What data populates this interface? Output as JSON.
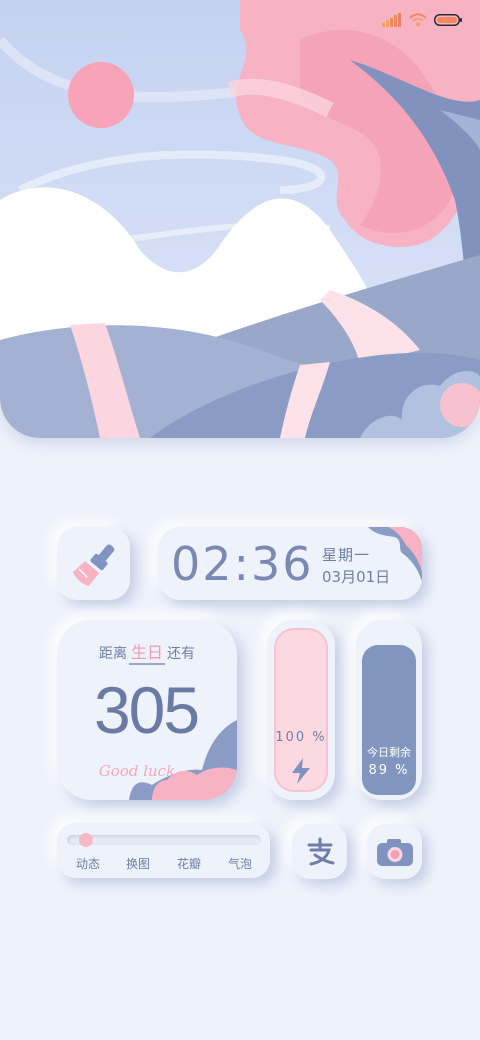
{
  "status_bar": {
    "icons": [
      "signal-icon",
      "wifi-icon",
      "battery-icon"
    ]
  },
  "clock": {
    "time": "02:36",
    "weekday": "星期一",
    "date": "03月01日"
  },
  "birthday": {
    "prefix": "距离",
    "highlight": "生日",
    "suffix": "还有",
    "days": "305",
    "caption": "Good luck"
  },
  "battery": {
    "percent_label": "100 %",
    "level": 1.0
  },
  "storage": {
    "label": "今日剩余",
    "percent_label": "89 %",
    "level": 0.89
  },
  "effects": {
    "items": [
      "动态",
      "换图",
      "花瓣",
      "气泡"
    ]
  },
  "apps": {
    "cleaner_icon": "broom-icon",
    "alipay_icon": "alipay-icon",
    "camera_icon": "camera-icon"
  },
  "colors": {
    "background": "#eef2fb",
    "pink": "#f7a8bd",
    "blue_gray": "#7f93bf",
    "text": "#6e7ea6"
  }
}
